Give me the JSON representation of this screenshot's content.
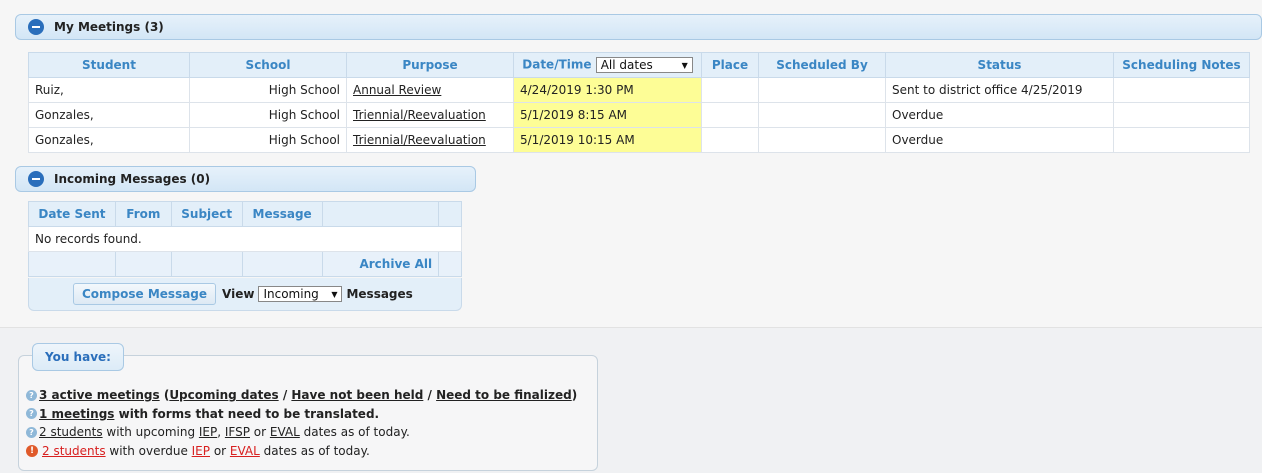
{
  "my_meetings": {
    "title": "My Meetings (3)",
    "columns": [
      "Student",
      "School",
      "Purpose",
      "Date/Time",
      "Place",
      "Scheduled By",
      "Status",
      "Scheduling Notes"
    ],
    "date_filter": "All dates",
    "rows": [
      {
        "student": "Ruiz,",
        "school": "High School",
        "purpose": "Annual Review",
        "datetime": "4/24/2019 1:30 PM",
        "place": "",
        "scheduled_by": "",
        "status": "Sent to district office 4/25/2019",
        "notes": ""
      },
      {
        "student": "Gonzales,",
        "school": "High School",
        "purpose": "Triennial/Reevaluation",
        "datetime": "5/1/2019 8:15 AM",
        "place": "",
        "scheduled_by": "",
        "status": "Overdue",
        "notes": ""
      },
      {
        "student": "Gonzales,",
        "school": "High School",
        "purpose": "Triennial/Reevaluation",
        "datetime": "5/1/2019 10:15 AM",
        "place": "",
        "scheduled_by": "",
        "status": "Overdue",
        "notes": ""
      }
    ]
  },
  "incoming": {
    "title": "Incoming Messages (0)",
    "columns": [
      "Date Sent",
      "From",
      "Subject",
      "Message"
    ],
    "empty": "No records found.",
    "archive_all": "Archive All",
    "compose": "Compose Message",
    "view_label": "View",
    "view_option": "Incoming",
    "messages_label": "Messages"
  },
  "you_have": {
    "title": "You have:",
    "line1": {
      "link": "3 active meetings",
      "open": " (",
      "upcoming": "Upcoming dates",
      "sep1": " / ",
      "not_held": "Have not been held",
      "sep2": " / ",
      "finalize": "Need to be finalized",
      "close": ")"
    },
    "line2": {
      "link": "1 meetings",
      "text": " with forms that need to be translated."
    },
    "line3": {
      "link": "2 students",
      "t1": " with upcoming ",
      "iep": "IEP",
      "c1": ", ",
      "ifsp": "IFSP",
      "t2": " or ",
      "eval": "EVAL",
      "t3": " dates as of today."
    },
    "line4": {
      "link": "2 students",
      "t1": " with overdue ",
      "iep": "IEP",
      "t2": " or ",
      "eval": "EVAL",
      "t3": " dates as of today."
    }
  },
  "colors": {
    "header_text": "#3a86c4",
    "highlight": "#fdfd96",
    "alert": "#d82020"
  }
}
